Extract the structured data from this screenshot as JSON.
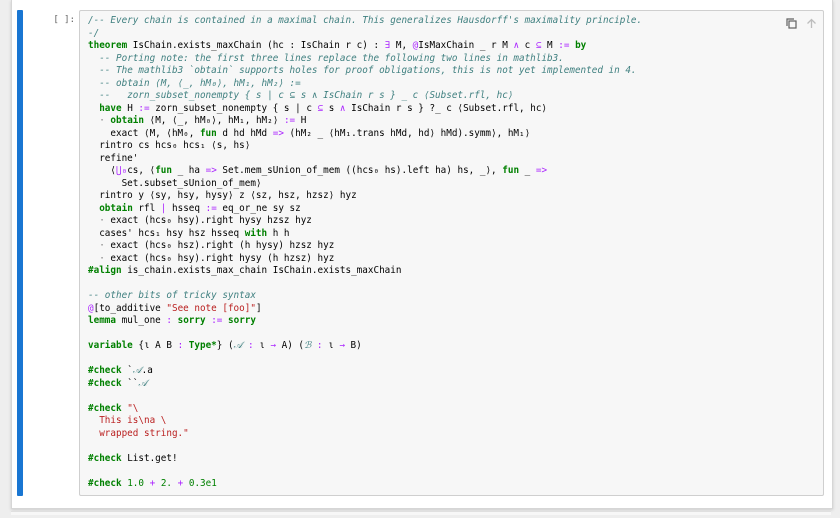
{
  "cell": {
    "prompt": "[ ]:",
    "toolbar": [
      "duplicate-cell",
      "move-cell-up",
      "move-cell-down",
      "insert-cell",
      "delete-cell"
    ]
  },
  "code_lines": [
    [
      [
        "cm",
        "/-- Every chain is contained in a maximal chain. This generalizes Hausdorff's maximality principle."
      ]
    ],
    [
      [
        "cm",
        "-/"
      ]
    ],
    [
      [
        "kw",
        "theorem"
      ],
      [
        "",
        " IsChain.exists_maxChain (hc : IsChain r c) : "
      ],
      [
        "op",
        "∃"
      ],
      [
        "",
        " M, "
      ],
      [
        "op",
        "@"
      ],
      [
        "",
        "IsMaxChain _ r M "
      ],
      [
        "op",
        "∧"
      ],
      [
        "",
        " c "
      ],
      [
        "op",
        "⊆"
      ],
      [
        "",
        " M "
      ],
      [
        "op",
        ":="
      ],
      [
        "",
        " "
      ],
      [
        "kw",
        "by"
      ]
    ],
    [
      [
        "",
        "  "
      ],
      [
        "cm",
        "-- Porting note: the first three lines replace the following two lines in mathlib3."
      ]
    ],
    [
      [
        "",
        "  "
      ],
      [
        "cm",
        "-- The mathlib3 `obtain` supports holes for proof obligations, this is not yet implemented in 4."
      ]
    ],
    [
      [
        "",
        "  "
      ],
      [
        "cm",
        "-- obtain ⟨M, ⟨_, hM₀⟩, hM₁, hM₂⟩ :="
      ]
    ],
    [
      [
        "",
        "  "
      ],
      [
        "cm",
        "--   zorn_subset_nonempty { s | c ⊆ s ∧ IsChain r s } _ c ⟨Subset.rfl, hc⟩"
      ]
    ],
    [
      [
        "",
        "  "
      ],
      [
        "kw",
        "have"
      ],
      [
        "",
        " H "
      ],
      [
        "op",
        ":="
      ],
      [
        "",
        " zorn_subset_nonempty { s | c "
      ],
      [
        "op",
        "⊆"
      ],
      [
        "",
        " s "
      ],
      [
        "op",
        "∧"
      ],
      [
        "",
        " IsChain r s } ?_ c ⟨Subset.rfl, hc⟩"
      ]
    ],
    [
      [
        "",
        "  "
      ],
      [
        "tac",
        "·"
      ],
      [
        "",
        " "
      ],
      [
        "kw",
        "obtain"
      ],
      [
        "",
        " ⟨M, ⟨_, hM₀⟩, hM₁, hM₂⟩ "
      ],
      [
        "op",
        ":="
      ],
      [
        "",
        " H"
      ]
    ],
    [
      [
        "",
        "    exact ⟨M, ⟨hM₀, "
      ],
      [
        "kw",
        "fun"
      ],
      [
        "",
        " d hd hMd "
      ],
      [
        "op",
        "=>"
      ],
      [
        "",
        " (hM₂ _ ⟨hM₁.trans hMd, hd⟩ hMd).symm⟩, hM₁⟩"
      ]
    ],
    [
      [
        "",
        "  rintro cs hcs₀ hcs₁ ⟨s, hs⟩"
      ]
    ],
    [
      [
        "",
        "  refine'"
      ]
    ],
    [
      [
        "",
        "    ⟨"
      ],
      [
        "op",
        "⋃₀"
      ],
      [
        "",
        "cs, ⟨"
      ],
      [
        "kw",
        "fun"
      ],
      [
        "",
        " _ ha "
      ],
      [
        "op",
        "=>"
      ],
      [
        "",
        " Set.mem_sUnion_of_mem ((hcs₀ hs).left ha) hs, _⟩, "
      ],
      [
        "kw",
        "fun"
      ],
      [
        "",
        " _ "
      ],
      [
        "op",
        "=>"
      ]
    ],
    [
      [
        "",
        "      Set.subset_sUnion_of_mem⟩"
      ]
    ],
    [
      [
        "",
        "  rintro y ⟨sy, hsy, hysy⟩ z ⟨sz, hsz, hzsz⟩ hyz"
      ]
    ],
    [
      [
        "",
        "  "
      ],
      [
        "kw",
        "obtain"
      ],
      [
        "",
        " rfl "
      ],
      [
        "op",
        "|"
      ],
      [
        "",
        " hsseq "
      ],
      [
        "op",
        ":="
      ],
      [
        "",
        " eq_or_ne sy sz"
      ]
    ],
    [
      [
        "",
        "  "
      ],
      [
        "tac",
        "·"
      ],
      [
        "",
        " exact (hcs₀ hsy).right hysy hzsz hyz"
      ]
    ],
    [
      [
        "",
        "  cases' hcs₁ hsy hsz hsseq "
      ],
      [
        "kw",
        "with"
      ],
      [
        "",
        " h h"
      ]
    ],
    [
      [
        "",
        "  "
      ],
      [
        "tac",
        "·"
      ],
      [
        "",
        " exact (hcs₀ hsz).right (h hysy) hzsz hyz"
      ]
    ],
    [
      [
        "",
        "  "
      ],
      [
        "tac",
        "·"
      ],
      [
        "",
        " exact (hcs₀ hsy).right hysy (h hzsz) hyz"
      ]
    ],
    [
      [
        "kw",
        "#align"
      ],
      [
        "",
        " is_chain.exists_max_chain IsChain.exists_maxChain"
      ]
    ],
    [
      [
        "",
        ""
      ]
    ],
    [
      [
        "cm",
        "-- other bits of tricky syntax"
      ]
    ],
    [
      [
        "hl",
        "@"
      ],
      [
        "",
        "[to_additive "
      ],
      [
        "str",
        "\"See note [foo]\""
      ],
      [
        "",
        "]"
      ]
    ],
    [
      [
        "kw",
        "lemma"
      ],
      [
        "",
        " mul_one "
      ],
      [
        "op",
        ":"
      ],
      [
        "",
        " "
      ],
      [
        "kw",
        "sorry"
      ],
      [
        "",
        " "
      ],
      [
        "op",
        ":="
      ],
      [
        "",
        " "
      ],
      [
        "kw",
        "sorry"
      ]
    ],
    [
      [
        "",
        ""
      ]
    ],
    [
      [
        "kw",
        "variable"
      ],
      [
        "",
        " {ι A B "
      ],
      [
        "op",
        ":"
      ],
      [
        "",
        " "
      ],
      [
        "kw",
        "Type*"
      ],
      [
        "",
        "} ("
      ],
      [
        "cm",
        "𝒜"
      ],
      [
        "",
        " "
      ],
      [
        "op",
        ":"
      ],
      [
        "",
        " ι "
      ],
      [
        "op",
        "→"
      ],
      [
        "",
        " A) ("
      ],
      [
        "cm",
        "ℬ"
      ],
      [
        "",
        " "
      ],
      [
        "op",
        ":"
      ],
      [
        "",
        " ι "
      ],
      [
        "op",
        "→"
      ],
      [
        "",
        " B)"
      ]
    ],
    [
      [
        "",
        ""
      ]
    ],
    [
      [
        "kw",
        "#check"
      ],
      [
        "",
        " `"
      ],
      [
        "cm",
        "𝒜"
      ],
      [
        "",
        ".a"
      ]
    ],
    [
      [
        "kw",
        "#check"
      ],
      [
        "",
        " ``"
      ],
      [
        "cm",
        "𝒜"
      ]
    ],
    [
      [
        "",
        ""
      ]
    ],
    [
      [
        "kw",
        "#check"
      ],
      [
        "",
        " "
      ],
      [
        "str",
        "\"\\"
      ]
    ],
    [
      [
        "str",
        "  This is\\na \\"
      ]
    ],
    [
      [
        "str",
        "  wrapped string.\""
      ]
    ],
    [
      [
        "",
        ""
      ]
    ],
    [
      [
        "kw",
        "#check"
      ],
      [
        "",
        " List.get!"
      ]
    ],
    [
      [
        "",
        ""
      ]
    ],
    [
      [
        "kw",
        "#check"
      ],
      [
        "",
        " "
      ],
      [
        "num",
        "1.0"
      ],
      [
        "",
        " "
      ],
      [
        "op",
        "+"
      ],
      [
        "",
        " "
      ],
      [
        "num",
        "2."
      ],
      [
        "",
        " "
      ],
      [
        "op",
        "+"
      ],
      [
        "",
        " "
      ],
      [
        "num",
        "0.3e1"
      ]
    ]
  ],
  "colors": {
    "collapser": "#1976d2",
    "comment": "#408080",
    "keyword": "#008000",
    "string": "#ba2121",
    "operator": "#aa22ff"
  }
}
